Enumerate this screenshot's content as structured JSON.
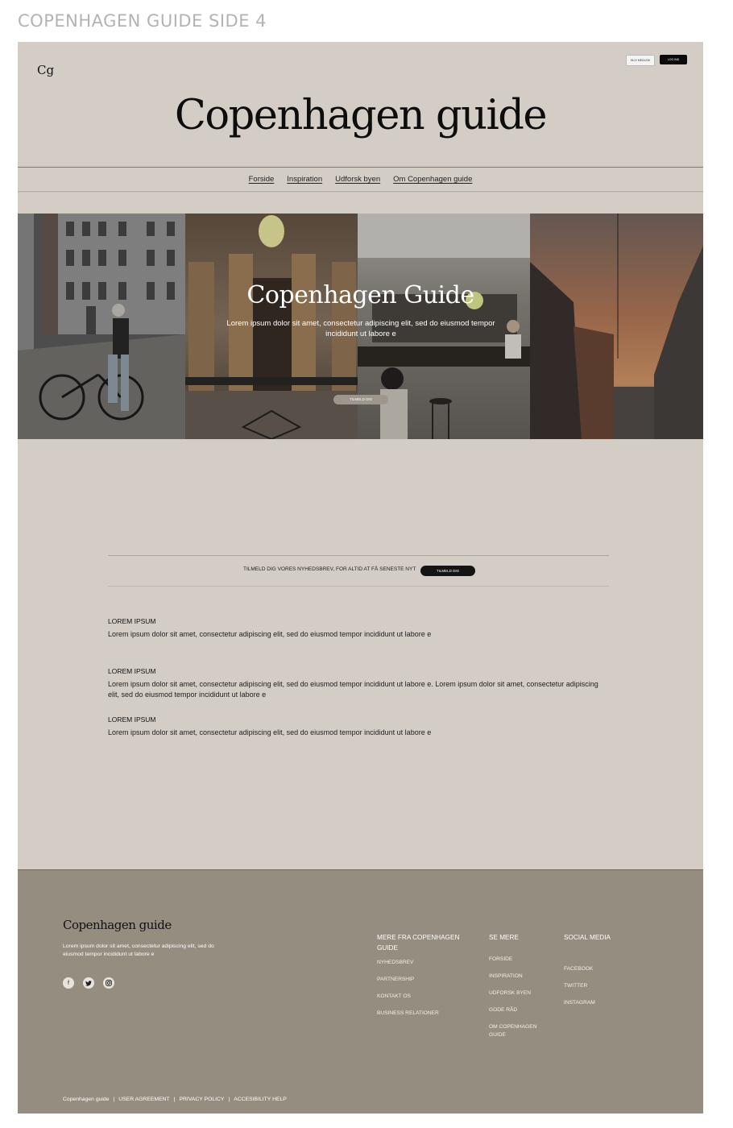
{
  "page_label": "COPENHAGEN GUIDE SIDE 4",
  "header": {
    "logo_main": "C",
    "logo_sub": "g",
    "btn_light": "BLIV MEDLEM",
    "btn_dark": "LOG IND",
    "title": "Copenhagen guide"
  },
  "nav": {
    "items": [
      "Forside",
      "Inspiration",
      "Udforsk byen",
      "Om Copenhagen guide"
    ]
  },
  "hero": {
    "title": "Copenhagen Guide",
    "text": "Lorem ipsum dolor sit amet, consectetur adipiscing elit, sed do eiusmod tempor incididunt ut labore e",
    "button": "TILMELD DIG"
  },
  "newsletter": {
    "text": "TILMELD DIG VORES NYHEDSBREV, FOR ALTID AT FÅ SENESTE NYT",
    "button": "TILMELD DIG"
  },
  "faq": [
    {
      "heading": "LOREM IPSUM",
      "body": "Lorem ipsum dolor sit amet, consectetur adipiscing elit, sed do eiusmod tempor incididunt ut labore e"
    },
    {
      "heading": "LOREM IPSUM",
      "body": "Lorem ipsum dolor sit amet, consectetur adipiscing elit, sed do eiusmod tempor incididunt ut labore e. Lorem ipsum dolor sit amet, consectetur adipiscing elit, sed do eiusmod tempor incididunt ut labore e"
    },
    {
      "heading": "LOREM IPSUM",
      "body": "Lorem ipsum dolor sit amet, consectetur adipiscing elit, sed do eiusmod tempor incididunt ut labore e"
    }
  ],
  "footer": {
    "brand": "Copenhagen guide",
    "description": "Lorem ipsum dolor sit amet, consectetur adipiscing elit, sed do eiusmod tempor incididunt ut labore e",
    "social_icons": [
      "facebook-icon",
      "twitter-icon",
      "instagram-icon"
    ],
    "col1": {
      "heading": "MERE FRA COPENHAGEN GUIDE",
      "links": [
        "NYHEDSBREV",
        "PARTNERSHIP",
        "KONTAKT OS",
        "BUSINESS RELATIONER"
      ]
    },
    "col2": {
      "heading": "SE MERE",
      "links": [
        "FORSIDE",
        "INSPIRATION",
        "UDFORSK BYEN",
        "GODE RÅD",
        "OM COPENHAGEN GUIDE"
      ]
    },
    "col3": {
      "heading": "SOCIAL MEDIA",
      "links": [
        "FACEBOOK",
        "TWITTER",
        "INSTAGRAM"
      ]
    },
    "bottom": [
      "Copenhagen guide",
      "|",
      "USER AGREEMENT",
      "|",
      "PRIVACY POLICY",
      "|",
      "ACCESIBILITY HELP"
    ]
  },
  "colors": {
    "page_bg": "#d3cdc5",
    "footer_bg": "#958d80",
    "dark": "#0b0b0b"
  }
}
